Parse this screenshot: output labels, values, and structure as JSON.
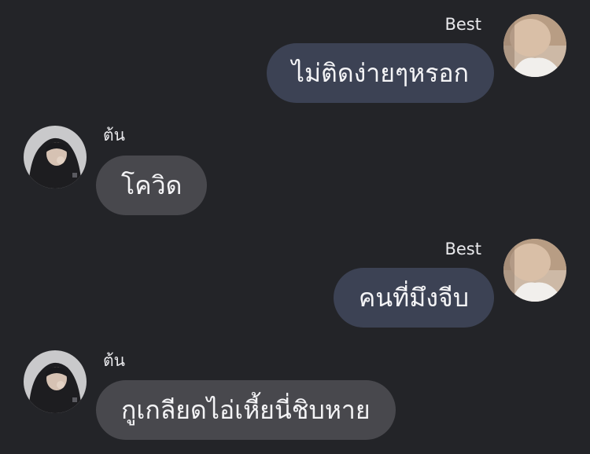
{
  "messages": [
    {
      "sender": "Best",
      "text": "ไม่ติดง่ายๆหรอก",
      "direction": "outgoing"
    },
    {
      "sender": "ต้น",
      "text": "โควิด",
      "direction": "incoming"
    },
    {
      "sender": "Best",
      "text": "คนที่มึงจีบ",
      "direction": "outgoing"
    },
    {
      "sender": "ต้น",
      "text": "กูเกลียดไอ่เหี้ยนี่ชิบหาย",
      "direction": "incoming"
    }
  ],
  "colors": {
    "background": "#232428",
    "outgoing_bubble": "#3c4254",
    "incoming_bubble": "#48484d",
    "text": "#f4f4f6"
  }
}
